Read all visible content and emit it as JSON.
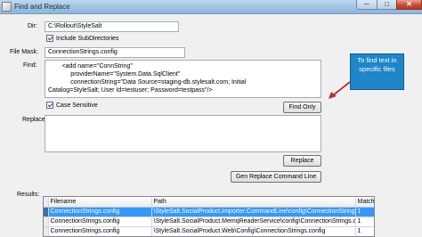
{
  "window": {
    "title": "Find and Replace",
    "minimize_glyph": "─",
    "maximize_glyph": "□",
    "close_glyph": "✕"
  },
  "dir": {
    "label": "Dir:",
    "value": "C:\\Rollout\\StyleSalt",
    "include_subdirs_label": "Include SubDirectories",
    "include_subdirs_checked": true
  },
  "file_mask": {
    "label": "File Mask:",
    "value": "ConnectionStrings.config"
  },
  "find": {
    "label": "Find:",
    "value": "        <add name=\"ConnString\"\n             providerName=\"System.Data.SqlClient\"\n             connectionString=\"Data Source=staging-db.stylesalt.com; Initial\nCatalog=StyleSalt; User Id=testuser; Password=testpass\"/>",
    "case_sensitive_label": "Case Sensitive",
    "case_sensitive_checked": true,
    "find_only_label": "Find Only"
  },
  "replace": {
    "label": "Replace:",
    "value": "",
    "replace_button_label": "Replace",
    "gen_command_label": "Gen Replace Command Line"
  },
  "callout": {
    "text": "To find text in specific files",
    "color": "#1e86c9",
    "arrow_color": "#c0282d"
  },
  "results": {
    "label": "Results:",
    "columns": [
      "Filename",
      "Path",
      "Matches"
    ],
    "rows": [
      {
        "filename": "ConnectionStrings.config",
        "path": "\\StyleSalt.SocialProduct.Importer.CommandLine\\config\\ConnectionStrings.config",
        "matches": "1"
      },
      {
        "filename": "ConnectionStrings.config",
        "path": "\\StyleSalt.SocialProduct.MemqReaderService\\config\\ConnectionStrings.config",
        "matches": "1"
      },
      {
        "filename": "ConnectionStrings.config",
        "path": "\\StyleSalt.SocialProduct.Web\\Config\\ConnectionStrings.config",
        "matches": "1"
      }
    ],
    "selected_row": 0
  }
}
